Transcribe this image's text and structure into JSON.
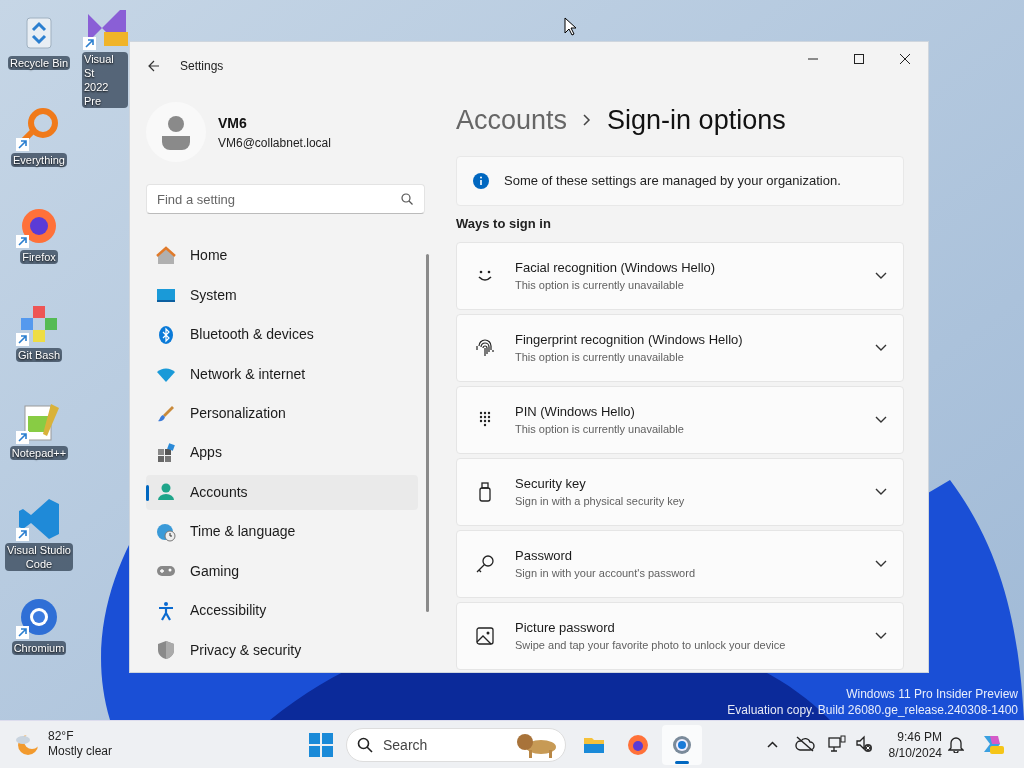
{
  "desktop_icons": [
    {
      "label": "Recycle Bin",
      "shortcut": false
    },
    {
      "label": "Visual St\n2022 Pre",
      "shortcut": true
    },
    {
      "label": "Everything",
      "shortcut": true
    },
    {
      "label": "Firefox",
      "shortcut": true
    },
    {
      "label": "Git Bash",
      "shortcut": true
    },
    {
      "label": "Notepad++",
      "shortcut": true
    },
    {
      "label": "Visual Studio\nCode",
      "shortcut": true
    },
    {
      "label": "Chromium",
      "shortcut": true
    }
  ],
  "window": {
    "title": "Settings"
  },
  "account": {
    "name": "VM6",
    "email": "VM6@collabnet.local"
  },
  "search": {
    "placeholder": "Find a setting"
  },
  "nav": [
    {
      "label": "Home",
      "selected": false
    },
    {
      "label": "System",
      "selected": false
    },
    {
      "label": "Bluetooth & devices",
      "selected": false
    },
    {
      "label": "Network & internet",
      "selected": false
    },
    {
      "label": "Personalization",
      "selected": false
    },
    {
      "label": "Apps",
      "selected": false
    },
    {
      "label": "Accounts",
      "selected": true
    },
    {
      "label": "Time & language",
      "selected": false
    },
    {
      "label": "Gaming",
      "selected": false
    },
    {
      "label": "Accessibility",
      "selected": false
    },
    {
      "label": "Privacy & security",
      "selected": false
    }
  ],
  "breadcrumb": [
    "Accounts",
    "Sign-in options"
  ],
  "info_banner": "Some of these settings are managed by your organization.",
  "section_title": "Ways to sign in",
  "options": [
    {
      "title": "Facial recognition (Windows Hello)",
      "subtitle": "This option is currently unavailable",
      "expanded": false
    },
    {
      "title": "Fingerprint recognition (Windows Hello)",
      "subtitle": "This option is currently unavailable",
      "expanded": false
    },
    {
      "title": "PIN (Windows Hello)",
      "subtitle": "This option is currently unavailable",
      "expanded": false
    },
    {
      "title": "Security key",
      "subtitle": "Sign in with a physical security key",
      "expanded": false
    },
    {
      "title": "Password",
      "subtitle": "Sign in with your account's password",
      "expanded": false
    },
    {
      "title": "Picture password",
      "subtitle": "Swipe and tap your favorite photo to unlock your device",
      "expanded": false
    }
  ],
  "os_watermark": [
    "Windows 11 Pro Insider Preview",
    "Evaluation copy. Build 26080.ge_release.240308-1400"
  ],
  "taskbar": {
    "weather": {
      "temp": "82°F",
      "condition": "Mostly clear"
    },
    "search_label": "Search",
    "apps": [
      {
        "active": false
      },
      {
        "active": false
      },
      {
        "active": true
      }
    ],
    "time": "9:46 PM",
    "date": "8/10/2024"
  }
}
